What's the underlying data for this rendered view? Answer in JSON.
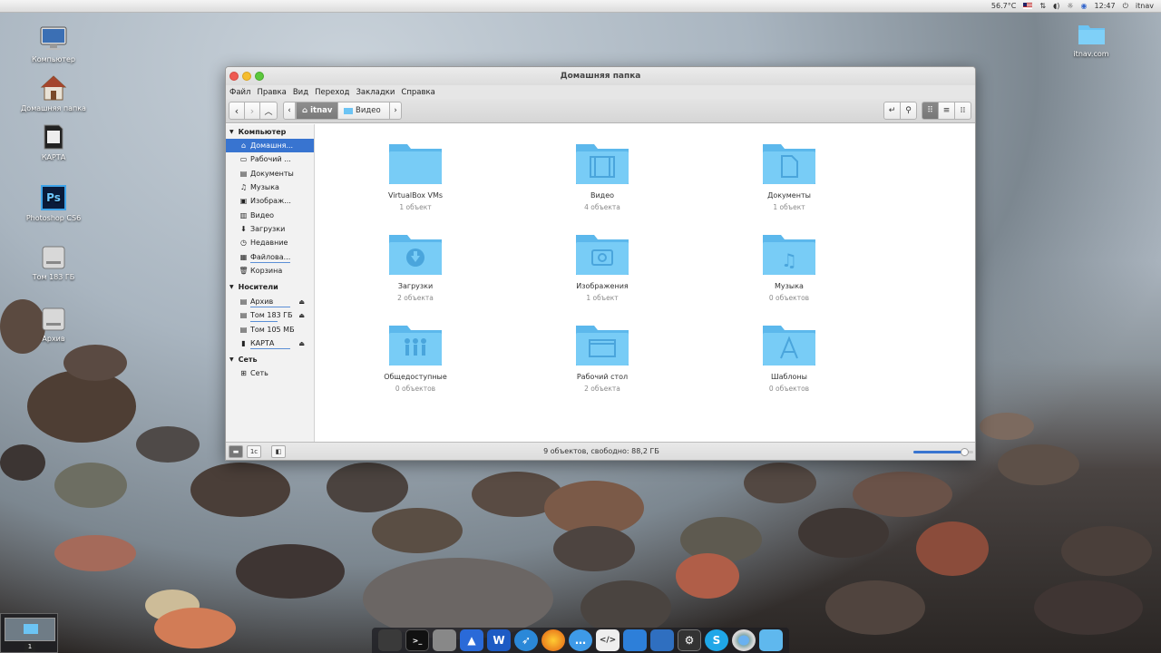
{
  "top_panel": {
    "temperature": "56.7°C",
    "time": "12:47",
    "user": "itnav",
    "icons": [
      "flag-us-icon",
      "network-icon",
      "volume-icon",
      "brightness-icon",
      "bluetooth-icon",
      "power-icon"
    ]
  },
  "desktop": {
    "icons": [
      {
        "label": "Компьютер",
        "icon": "computer-icon"
      },
      {
        "label": "Домашняя папка",
        "icon": "home-icon"
      },
      {
        "label": "КАРТА",
        "icon": "sd-card-icon"
      },
      {
        "label": "Photoshop CS6",
        "icon": "photoshop-icon"
      },
      {
        "label": "Том 183 ГБ",
        "icon": "drive-icon"
      },
      {
        "label": "Архив",
        "icon": "drive-icon"
      }
    ],
    "right_icon": {
      "label": "itnav.com",
      "icon": "folder-icon"
    }
  },
  "window": {
    "title": "Домашняя папка",
    "menu": [
      "Файл",
      "Правка",
      "Вид",
      "Переход",
      "Закладки",
      "Справка"
    ],
    "breadcrumbs": [
      {
        "label": "itnav",
        "icon": "home-icon"
      },
      {
        "label": "Видео",
        "icon": "folder-icon"
      }
    ],
    "sidebar": {
      "sections": [
        {
          "title": "Компьютер",
          "items": [
            {
              "label": "Домашня...",
              "icon": "home-icon",
              "active": true
            },
            {
              "label": "Рабочий ...",
              "icon": "desktop-icon"
            },
            {
              "label": "Документы",
              "icon": "documents-icon"
            },
            {
              "label": "Музыка",
              "icon": "headphones-icon"
            },
            {
              "label": "Изображ...",
              "icon": "pictures-icon"
            },
            {
              "label": "Видео",
              "icon": "video-icon"
            },
            {
              "label": "Загрузки",
              "icon": "download-icon"
            },
            {
              "label": "Недавние",
              "icon": "clock-icon"
            },
            {
              "label": "Файлова...",
              "icon": "filesystem-icon"
            },
            {
              "label": "Корзина",
              "icon": "trash-icon"
            }
          ]
        },
        {
          "title": "Носители",
          "items": [
            {
              "label": "Архив",
              "icon": "drive-icon",
              "eject": true
            },
            {
              "label": "Том 183 ГБ",
              "icon": "drive-icon",
              "eject": true
            },
            {
              "label": "Том 105 МБ",
              "icon": "drive-icon",
              "eject": false
            },
            {
              "label": "КАРТА",
              "icon": "sd-card-icon",
              "eject": true
            }
          ]
        },
        {
          "title": "Сеть",
          "items": [
            {
              "label": "Сеть",
              "icon": "network-icon"
            }
          ]
        }
      ]
    },
    "folders": [
      {
        "name": "VirtualBox VMs",
        "count": "1 объект",
        "emblem": "none"
      },
      {
        "name": "Видео",
        "count": "4 объекта",
        "emblem": "film"
      },
      {
        "name": "Документы",
        "count": "1 объект",
        "emblem": "document"
      },
      {
        "name": "Загрузки",
        "count": "2 объекта",
        "emblem": "download"
      },
      {
        "name": "Изображения",
        "count": "1 объект",
        "emblem": "camera"
      },
      {
        "name": "Музыка",
        "count": "0 объектов",
        "emblem": "music"
      },
      {
        "name": "Общедоступные",
        "count": "0 объектов",
        "emblem": "people"
      },
      {
        "name": "Рабочий стол",
        "count": "2 объекта",
        "emblem": "desktop"
      },
      {
        "name": "Шаблоны",
        "count": "0 объектов",
        "emblem": "template"
      }
    ],
    "status": "9 объектов, свободно: 88,2 ГБ",
    "zoom_level": 0.85
  },
  "dock": {
    "apps": [
      "files-app-icon",
      "terminal-icon",
      "usb-icon",
      "deepin-icon",
      "wps-writer-icon",
      "browser-bird-icon",
      "firefox-icon",
      "chat-icon",
      "code-editor-icon",
      "screenshot-icon",
      "system-monitor-icon",
      "settings-icon",
      "skype-icon",
      "chromium-icon",
      "files-folder-icon"
    ]
  },
  "workspace": {
    "number": "1"
  },
  "colors": {
    "accent": "#3874d0",
    "folder": "#6cc4f4"
  }
}
